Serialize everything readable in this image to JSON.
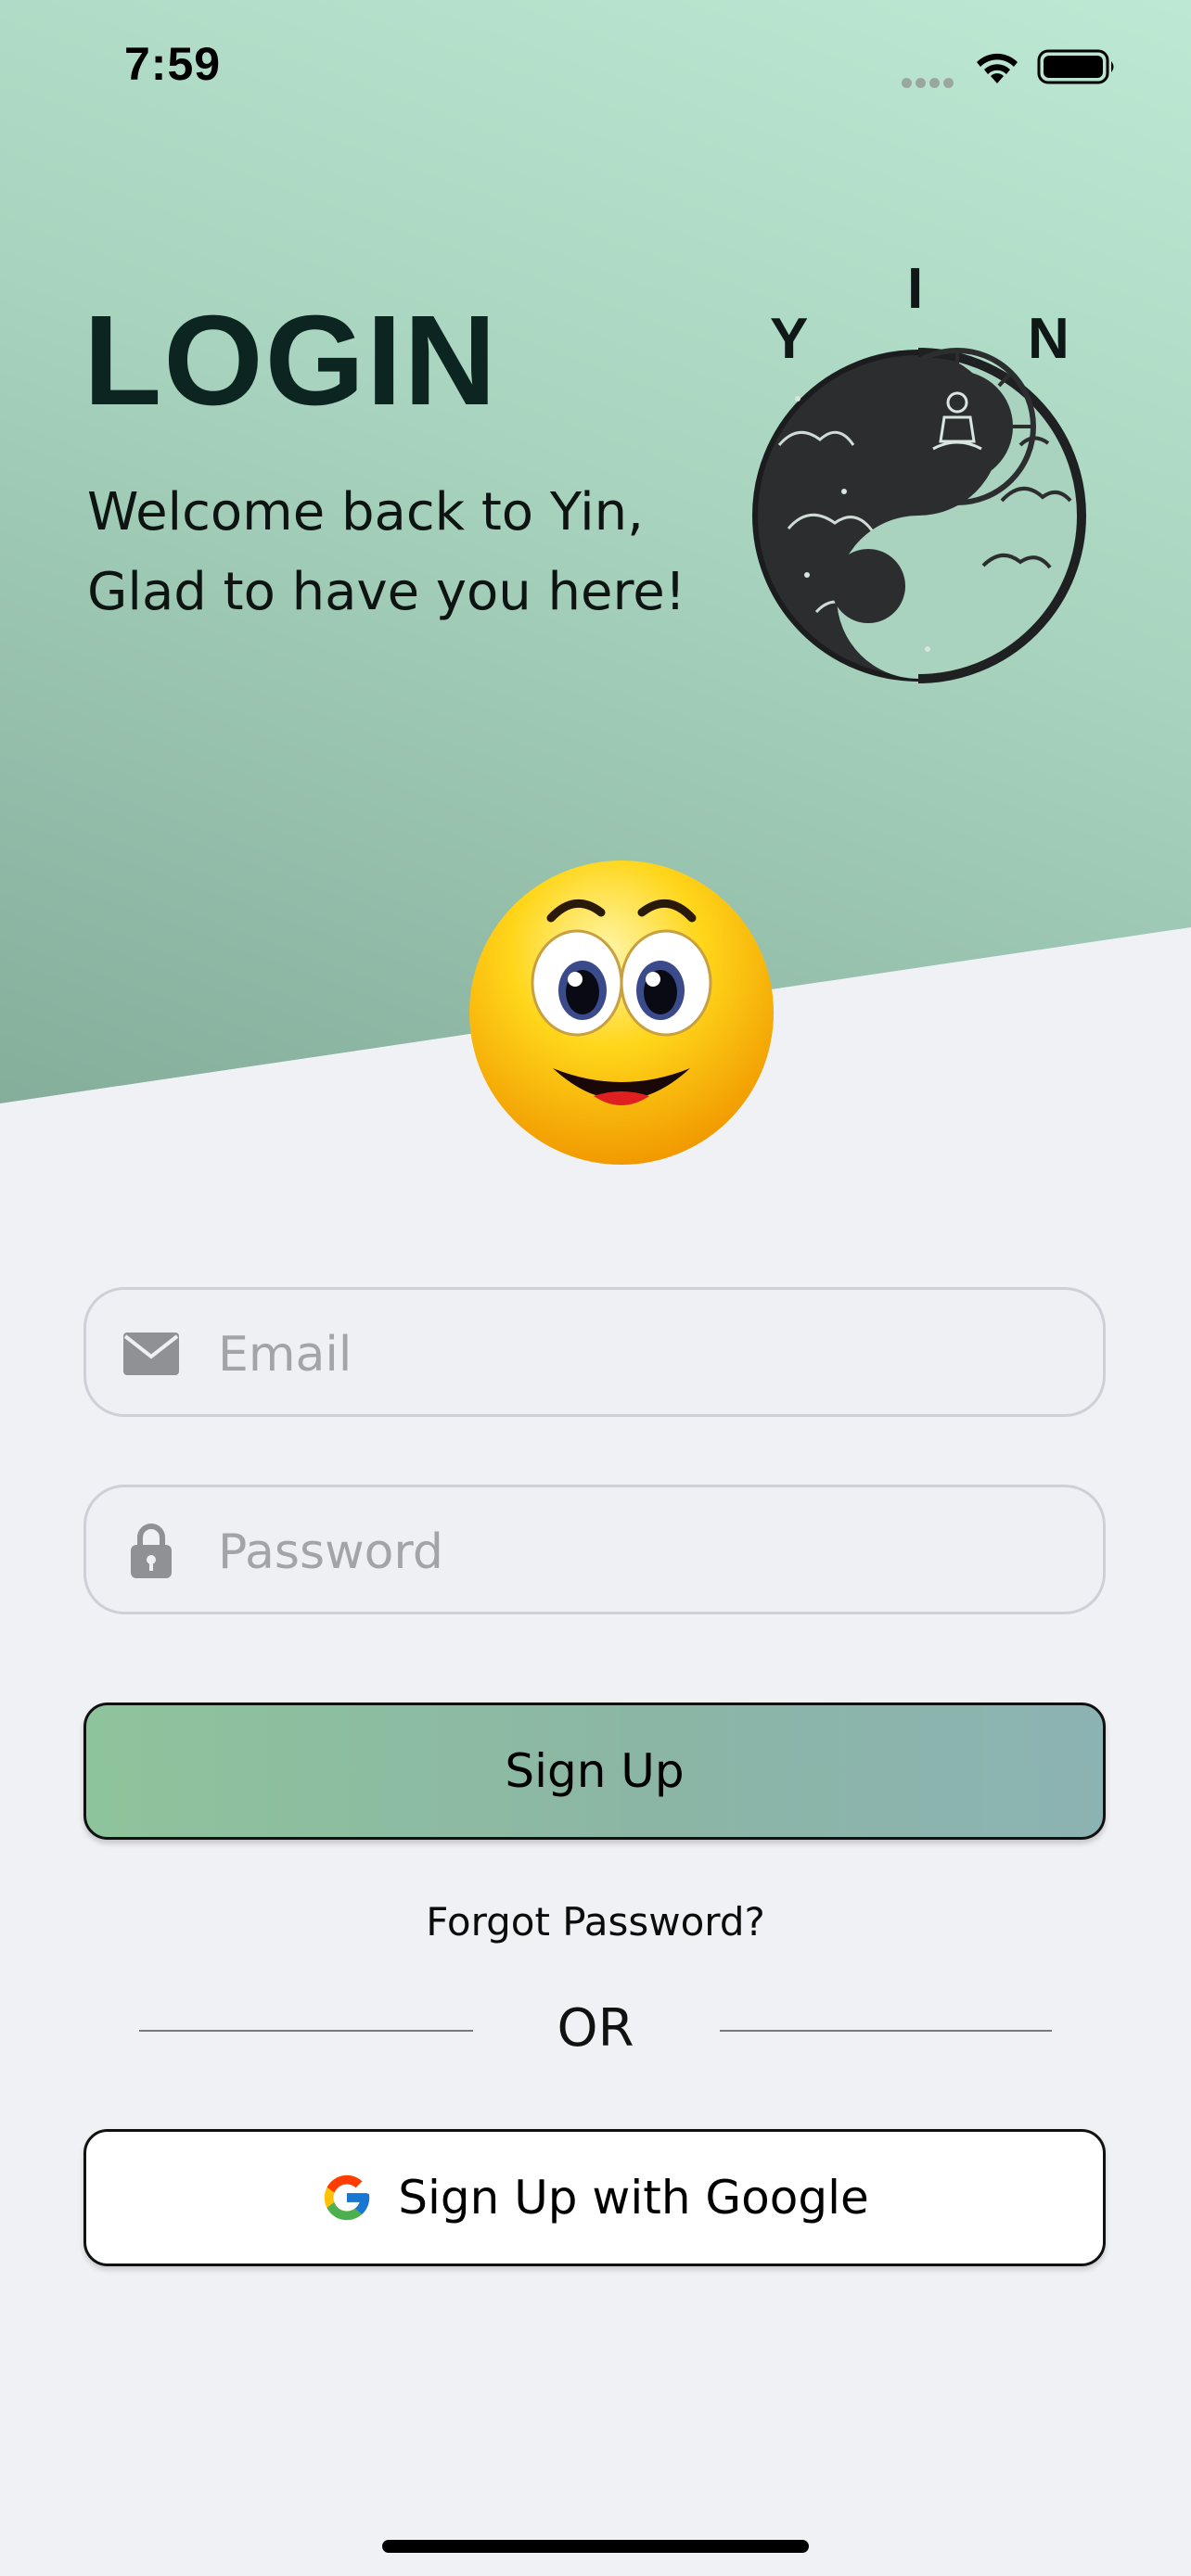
{
  "status_bar": {
    "time": "7:59",
    "icons": [
      "cellular-signal-icon",
      "wifi-icon",
      "battery-icon"
    ]
  },
  "header": {
    "title": "LOGIN",
    "welcome_line1": "Welcome back to Yin,",
    "welcome_line2": "Glad to have you here!"
  },
  "logo": {
    "letters": [
      "Y",
      "I",
      "N"
    ],
    "description_icon": "yin-yang-logo-icon"
  },
  "mascot": {
    "icon": "smiling-emoji-icon"
  },
  "form": {
    "email_placeholder": "Email",
    "email_icon": "envelope-icon",
    "password_placeholder": "Password",
    "password_icon": "lock-icon",
    "submit_label": "Sign Up"
  },
  "forgot_password": "Forgot Password?",
  "divider_text": "OR",
  "google_button": {
    "label": "Sign Up with Google",
    "icon": "google-g-icon"
  },
  "colors": {
    "hero_gradient_top": "#bde9d4",
    "hero_gradient_bottom": "#84ad9a",
    "background": "#f0f1f5",
    "button_gradient_start": "#8ec49c",
    "button_gradient_end": "#8cb3b3",
    "title_color": "#0d2520"
  }
}
